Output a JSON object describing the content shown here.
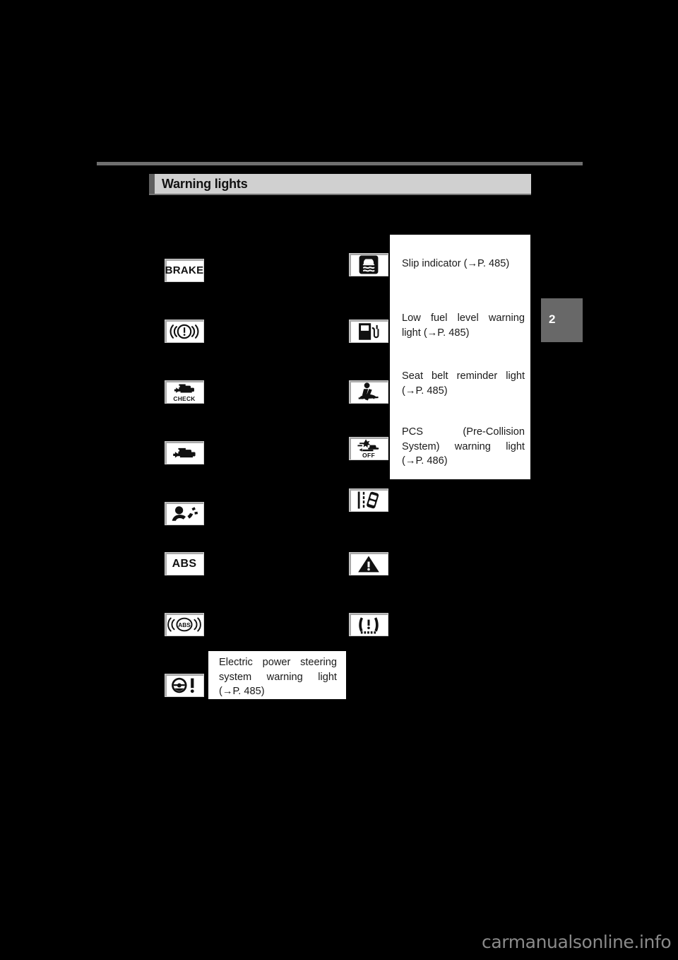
{
  "page": {
    "background_color": "#000000",
    "chapter_tab": "2",
    "watermark": "carmanualsonline.info"
  },
  "header": {
    "title": "Warning lights"
  },
  "left_column": {
    "items": [
      {
        "icon": "brake-warning-light-icon",
        "icon_label": "BRAKE",
        "text": ""
      },
      {
        "icon": "brake-system-warning-light-icon",
        "icon_label": "",
        "text": ""
      },
      {
        "icon": "engine-check-warning-light-icon",
        "icon_label": "CHECK",
        "text": ""
      },
      {
        "icon": "malfunction-indicator-lamp-icon",
        "icon_label": "",
        "text": ""
      },
      {
        "icon": "srs-airbag-warning-light-icon",
        "icon_label": "",
        "text": ""
      },
      {
        "icon": "abs-warning-light-icon",
        "icon_label": "ABS",
        "text": ""
      },
      {
        "icon": "brake-assist-abs-warning-light-icon",
        "icon_label": "ABS",
        "text": ""
      },
      {
        "icon": "electric-power-steering-warning-light-icon",
        "icon_label": "",
        "text": "Electric power steering system warning light (→P. 485)"
      }
    ]
  },
  "right_column": {
    "items": [
      {
        "icon": "slip-indicator-icon",
        "icon_label": "",
        "text": "Slip indicator (→P. 485)"
      },
      {
        "icon": "low-fuel-level-warning-icon",
        "icon_label": "",
        "text": "Low fuel level warning light (→P. 485)"
      },
      {
        "icon": "seat-belt-reminder-icon",
        "icon_label": "",
        "text": "Seat belt reminder light (→P. 485)"
      },
      {
        "icon": "pcs-warning-light-icon",
        "icon_label": "OFF",
        "text": "PCS (Pre-Collision System) warning light (→P. 486)"
      },
      {
        "icon": "lda-lane-departure-alert-icon",
        "icon_label": "",
        "text": ""
      },
      {
        "icon": "master-warning-light-icon",
        "icon_label": "",
        "text": ""
      },
      {
        "icon": "tire-pressure-warning-light-icon",
        "icon_label": "",
        "text": ""
      }
    ]
  },
  "panels": {
    "right_panel_lines": [
      "Slip indicator (→P. 485)",
      "Low  fuel  level  warning light (→P. 485)",
      "Seat  belt  reminder  light (→P. 485)",
      "PCS (Pre-Collision Sys-tem) warning light (→P. 486)"
    ],
    "eps_panel_text": "Electric  power  steering system warning light (→P. 485)"
  },
  "entries": {
    "slip_indicator": "Slip indicator (→P. 485)",
    "low_fuel": "Low fuel level warning light (→P. 485)",
    "seat_belt": "Seat belt reminder light (→P. 485)",
    "pcs": "PCS (Pre-Collision System) warning light (→P. 486)",
    "eps": "Electric power steering system warning light (→P. 485)"
  }
}
